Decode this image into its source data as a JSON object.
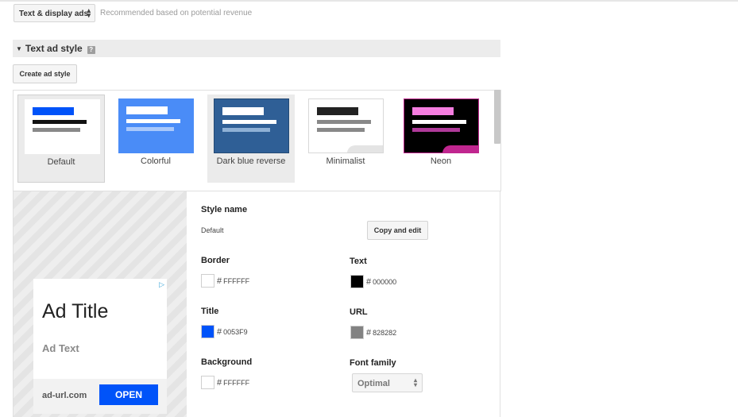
{
  "ad_type": {
    "selected": "Text & display ads",
    "hint": "Recommended based on potential revenue"
  },
  "section": {
    "title": "Text ad style",
    "help_glyph": "?"
  },
  "create_button": "Create ad style",
  "styles": [
    {
      "label": "Default",
      "selected": true,
      "thumb_bg": "#ffffff",
      "title_color": "#0053f9",
      "text_color": "#111111",
      "url_color": "#888888"
    },
    {
      "label": "Colorful",
      "selected": false,
      "thumb_bg": "#4a8cf7",
      "title_color": "#ffffff",
      "text_color": "#ffffff",
      "url_color": "#a9c8fb"
    },
    {
      "label": "Dark blue reverse",
      "selected": false,
      "thumb_bg": "#2f5f96",
      "title_color": "#ffffff",
      "text_color": "#ffffff",
      "url_color": "#8fb1d6"
    },
    {
      "label": "Minimalist",
      "selected": false,
      "thumb_bg": "#ffffff",
      "title_color": "#222222",
      "text_color": "#888888",
      "url_color": "#888888"
    },
    {
      "label": "Neon",
      "selected": false,
      "thumb_bg": "#000000",
      "title_color": "#f57de0",
      "text_color": "#ffffff",
      "url_color": "#b03a9a"
    }
  ],
  "preview": {
    "ad_choices": "▷",
    "title": "Ad Title",
    "text": "Ad Text",
    "url": "ad-url.com",
    "cta": "OPEN"
  },
  "form": {
    "style_name_label": "Style name",
    "style_name_value": "Default",
    "copy_button": "Copy and edit",
    "border_label": "Border",
    "border_hex": "FFFFFF",
    "border_color": "#FFFFFF",
    "text_label": "Text",
    "text_hex": "000000",
    "text_color": "#000000",
    "title_label": "Title",
    "title_hex": "0053F9",
    "title_color": "#0053F9",
    "url_label": "URL",
    "url_hex": "828282",
    "url_color": "#828282",
    "background_label": "Background",
    "background_hex": "FFFFFF",
    "background_color": "#FFFFFF",
    "font_family_label": "Font family",
    "font_family_value": "Optimal",
    "hash": "#"
  }
}
